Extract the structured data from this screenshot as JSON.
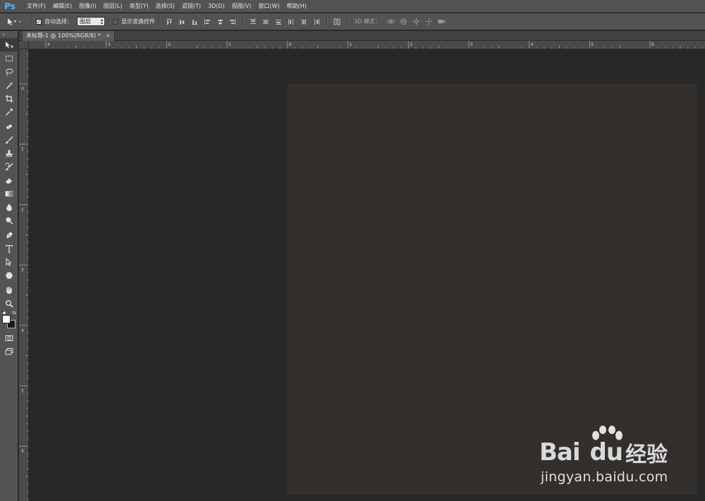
{
  "app": {
    "logo": "Ps"
  },
  "menu": [
    {
      "label": "文件(F)"
    },
    {
      "label": "编辑(E)"
    },
    {
      "label": "图像(I)"
    },
    {
      "label": "图层(L)"
    },
    {
      "label": "类型(Y)"
    },
    {
      "label": "选择(S)"
    },
    {
      "label": "滤镜(T)"
    },
    {
      "label": "3D(D)"
    },
    {
      "label": "视图(V)"
    },
    {
      "label": "窗口(W)"
    },
    {
      "label": "帮助(H)"
    }
  ],
  "options": {
    "auto_select_label": "自动选择：",
    "auto_select_checked": true,
    "auto_select_target": "图层",
    "show_transform_label": "显示变换控件",
    "show_transform_checked": false,
    "three_d_mode_label": "3D 模式："
  },
  "document": {
    "tab_title": "未标题-1 @ 100%(RGB/8) *",
    "close_glyph": "×"
  },
  "rulers": {
    "horizontal_labels": [
      "4",
      "3",
      "2",
      "1",
      "0",
      "1",
      "2",
      "3",
      "4",
      "5",
      "6"
    ],
    "vertical_labels": [
      "0",
      "1",
      "2",
      "3",
      "4",
      "5",
      "6"
    ]
  },
  "colors": {
    "accent": "#5ab4ff",
    "chrome": "#535353",
    "workarea": "#282828",
    "document": "#322f2c",
    "foreground_swatch": "#ffffff",
    "background_swatch": "#1a1a1a"
  },
  "tools": [
    "move-tool",
    "marquee-tool",
    "lasso-tool",
    "quick-select-tool",
    "crop-tool",
    "eyedropper-tool",
    "healing-tool",
    "brush-tool",
    "stamp-tool",
    "history-brush-tool",
    "eraser-tool",
    "gradient-tool",
    "blur-tool",
    "dodge-tool",
    "pen-tool",
    "type-tool",
    "path-select-tool",
    "shape-tool",
    "hand-tool",
    "zoom-tool"
  ],
  "watermark": {
    "brand": "Bai",
    "brand_suffix": "du",
    "cn": "经验",
    "url": "jingyan.baidu.com"
  }
}
